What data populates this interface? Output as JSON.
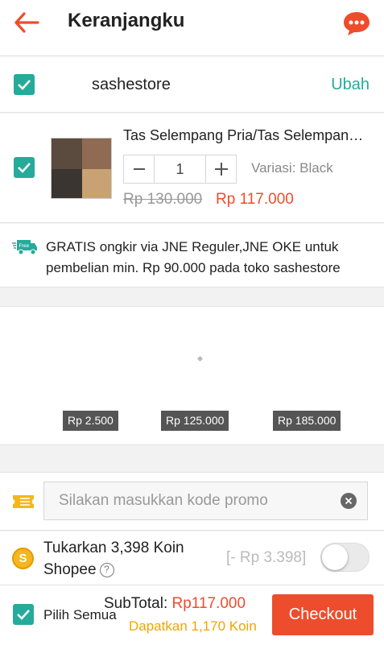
{
  "header": {
    "title": "Keranjangku"
  },
  "shop": {
    "name": "sashestore",
    "edit_label": "Ubah"
  },
  "product": {
    "name": "Tas Selempang Pria/Tas Selempang Pria",
    "quantity": "1",
    "variant": "Variasi: Black",
    "original_price": "Rp 130.000",
    "price": "Rp 117.000"
  },
  "shipping": {
    "text": "GRATIS ongkir via JNE Reguler,JNE OKE untuk pembelian min. Rp 90.000 pada toko sashestore"
  },
  "price_ruler": {
    "ticks": [
      "Rp 2.500",
      "Rp 125.000",
      "Rp 185.000"
    ]
  },
  "promo": {
    "placeholder": "Silakan masukkan kode promo"
  },
  "coins": {
    "label_line1": "Tukarkan 3,398 Koin",
    "label_line2": "Shopee",
    "deduction": "[- Rp 3.398]",
    "toggle_on": false
  },
  "footer": {
    "select_all": "Pilih Semua",
    "subtotal_label": "SubTotal: ",
    "subtotal_value": "Rp117.000",
    "earn_coins": "Dapatkan 1,170 Koin",
    "checkout_label": "Checkout"
  },
  "colors": {
    "accent": "#ee4d2d",
    "teal": "#26aa99",
    "coin": "#f0a500"
  }
}
